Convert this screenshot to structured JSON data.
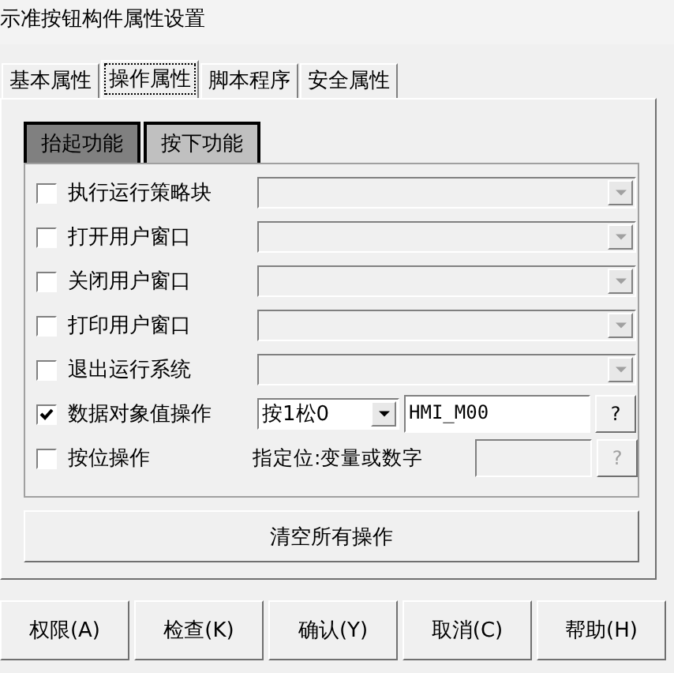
{
  "window": {
    "title": "示准按钮构件属性设置"
  },
  "tabs": [
    {
      "label": "基本属性",
      "selected": false
    },
    {
      "label": "操作属性",
      "selected": true
    },
    {
      "label": "脚本程序",
      "selected": false
    },
    {
      "label": "安全属性",
      "selected": false
    }
  ],
  "function_tabs": [
    {
      "label": "抬起功能",
      "selected": true
    },
    {
      "label": "按下功能",
      "selected": false
    }
  ],
  "actions": [
    {
      "kind": "dropdown",
      "label": "执行运行策略块",
      "checked": false,
      "disabled": true
    },
    {
      "kind": "dropdown",
      "label": "打开用户窗口",
      "checked": false,
      "disabled": true
    },
    {
      "kind": "dropdown",
      "label": "关闭用户窗口",
      "checked": false,
      "disabled": true
    },
    {
      "kind": "dropdown",
      "label": "打印用户窗口",
      "checked": false,
      "disabled": true
    },
    {
      "kind": "dropdown",
      "label": "退出运行系统",
      "checked": false,
      "disabled": true
    },
    {
      "kind": "value_op",
      "label": "数据对象值操作",
      "checked": true,
      "operation": "按1松0",
      "variable": "HMI_M00",
      "help": "?",
      "disabled": false
    },
    {
      "kind": "bit_op",
      "label": "按位操作",
      "checked": false,
      "hint": "指定位:变量或数字",
      "help": "?",
      "disabled": true
    }
  ],
  "clear_button": "清空所有操作",
  "buttons": [
    "权限(A)",
    "检查(K)",
    "确认(Y)",
    "取消(C)",
    "帮助(H)"
  ]
}
